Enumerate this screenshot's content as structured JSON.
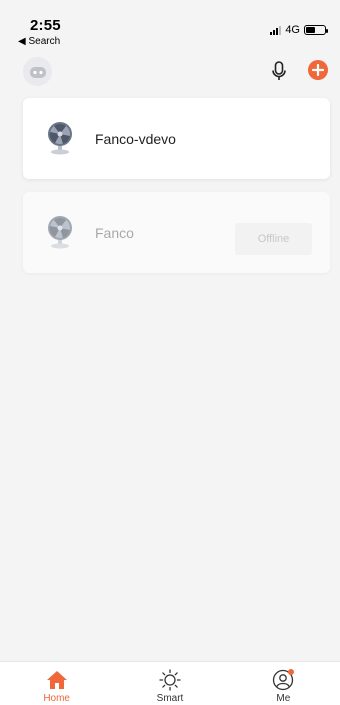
{
  "statusbar": {
    "time": "2:55",
    "back": "◀ Search",
    "network": "4G"
  },
  "topbar": {
    "avatar_icon": "robot-icon",
    "mic_icon": "mic-icon",
    "add_icon": "plus-icon"
  },
  "devices": [
    {
      "name": "Fanco-vdevo",
      "status": "online",
      "icon": "fan-icon"
    },
    {
      "name": "Fanco",
      "status": "offline",
      "status_label": "Offline",
      "icon": "fan-icon"
    }
  ],
  "tabbar": {
    "tabs": [
      {
        "label": "Home",
        "icon": "home-icon",
        "active": true
      },
      {
        "label": "Smart",
        "icon": "sun-icon",
        "active": false
      },
      {
        "label": "Me",
        "icon": "user-icon",
        "active": false
      }
    ]
  },
  "colors": {
    "accent": "#f0673a",
    "background": "#f4f4f4",
    "card": "#ffffff"
  }
}
